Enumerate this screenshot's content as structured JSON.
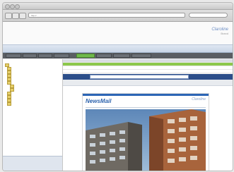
{
  "browser": {
    "address": "http://",
    "colors": {
      "chrome": "#d6d6d6"
    }
  },
  "app": {
    "brand_line1": "Claroline",
    "brand_line2": "Brand"
  },
  "tabs": [
    {
      "label": ""
    },
    {
      "label": ""
    },
    {
      "label": ""
    },
    {
      "label": ""
    },
    {
      "label": ""
    }
  ],
  "toolbar": {
    "buttons": [
      {
        "label": ""
      },
      {
        "label": ""
      },
      {
        "label": ""
      },
      {
        "label": ""
      },
      {
        "label": ""
      },
      {
        "label": ""
      },
      {
        "label": ""
      },
      {
        "label": ""
      }
    ],
    "colors": {
      "bar": "#5a5e63",
      "active": "#6fb84a"
    }
  },
  "sidebar": {
    "folders": [
      {
        "label": ""
      },
      {
        "label": ""
      },
      {
        "label": ""
      },
      {
        "label": ""
      },
      {
        "label": ""
      },
      {
        "label": ""
      },
      {
        "label": ""
      },
      {
        "label": ""
      },
      {
        "label": ""
      },
      {
        "label": ""
      },
      {
        "label": ""
      },
      {
        "label": ""
      }
    ],
    "footer": [
      {
        "label": ""
      },
      {
        "label": ""
      }
    ]
  },
  "message_list": {
    "rows": [
      {
        "from": "",
        "subject": "",
        "date": "",
        "size": ""
      },
      {
        "from": "",
        "subject": "",
        "date": "",
        "size": ""
      },
      {
        "from": "",
        "subject": "",
        "date": "",
        "size": ""
      },
      {
        "from": "",
        "subject": "",
        "date": "",
        "size": ""
      }
    ],
    "colors": {
      "selected": "#8cc84b"
    }
  },
  "preview": {
    "from": "",
    "colors": {
      "bar": "#2c4e8a"
    }
  },
  "newsletter": {
    "title": "NewsMail",
    "logo_line1": "Claroline",
    "logo_line2": "",
    "colors": {
      "accent": "#2d63ad"
    }
  }
}
